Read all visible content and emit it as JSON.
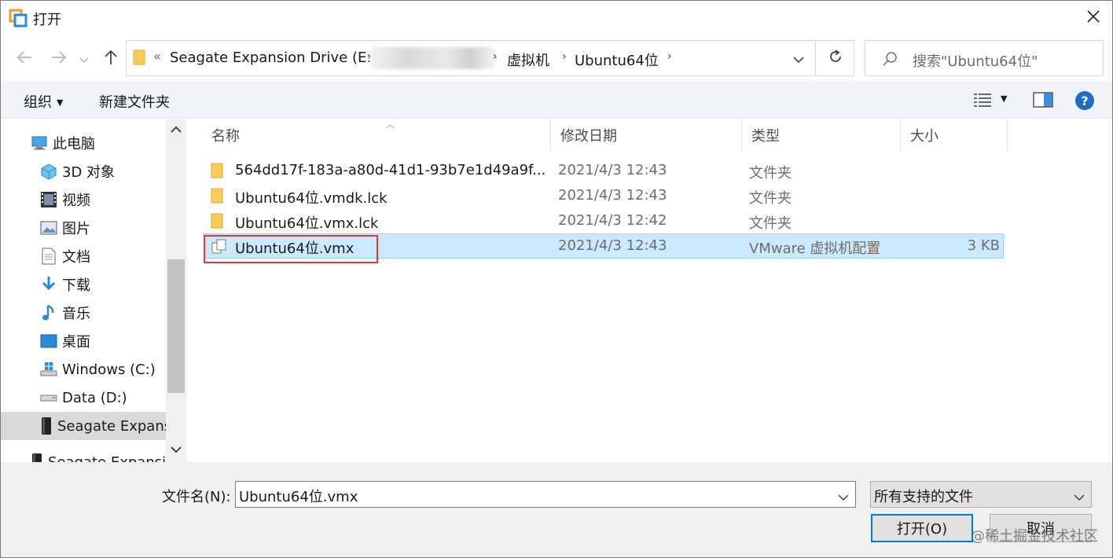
{
  "window": {
    "title": "打开"
  },
  "address": {
    "breadcrumbs": [
      "Seagate Expansion Drive (E:)",
      "虚拟机",
      "Ubuntu64位"
    ],
    "overflow_glyph": "«"
  },
  "search": {
    "placeholder": "搜索\"Ubuntu64位\""
  },
  "toolbar": {
    "organize_label": "组织",
    "new_folder_label": "新建文件夹"
  },
  "nav": {
    "items": [
      {
        "label": "此电脑",
        "icon": "computer-icon"
      },
      {
        "label": "3D 对象",
        "icon": "3d-objects-icon"
      },
      {
        "label": "视频",
        "icon": "video-icon"
      },
      {
        "label": "图片",
        "icon": "pictures-icon"
      },
      {
        "label": "文档",
        "icon": "documents-icon"
      },
      {
        "label": "下载",
        "icon": "download-icon"
      },
      {
        "label": "音乐",
        "icon": "music-icon"
      },
      {
        "label": "桌面",
        "icon": "desktop-icon"
      },
      {
        "label": "Windows (C:)",
        "icon": "windows-drive-icon"
      },
      {
        "label": "Data (D:)",
        "icon": "drive-icon"
      },
      {
        "label": "Seagate Expans",
        "icon": "external-drive-icon"
      },
      {
        "label": "Seagate Expansi",
        "icon": "external-drive-icon"
      }
    ]
  },
  "columns": {
    "name": "名称",
    "modified": "修改日期",
    "type": "类型",
    "size": "大小"
  },
  "files": [
    {
      "name": "564dd17f-183a-a80d-41d1-93b7e1d49a9f...",
      "modified": "2021/4/3 12:43",
      "type": "文件夹",
      "size": "",
      "icon": "folder-icon"
    },
    {
      "name": "Ubuntu64位.vmdk.lck",
      "modified": "2021/4/3 12:43",
      "type": "文件夹",
      "size": "",
      "icon": "folder-icon"
    },
    {
      "name": "Ubuntu64位.vmx.lck",
      "modified": "2021/4/3 12:42",
      "type": "文件夹",
      "size": "",
      "icon": "folder-icon"
    },
    {
      "name": "Ubuntu64位.vmx",
      "modified": "2021/4/3 12:43",
      "type": "VMware 虚拟机配置",
      "size": "3 KB",
      "icon": "vmx-file-icon"
    }
  ],
  "bottom": {
    "filename_label": "文件名(N):",
    "filename_value": "Ubuntu64位.vmx",
    "filter_value": "所有支持的文件",
    "open_label": "打开(O)",
    "cancel_label": "取消"
  },
  "watermark": "@稀土掘金技术社区",
  "colors": {
    "selection": "#cce8ff",
    "accent": "#0078d7",
    "highlight": "#e03b3b"
  }
}
